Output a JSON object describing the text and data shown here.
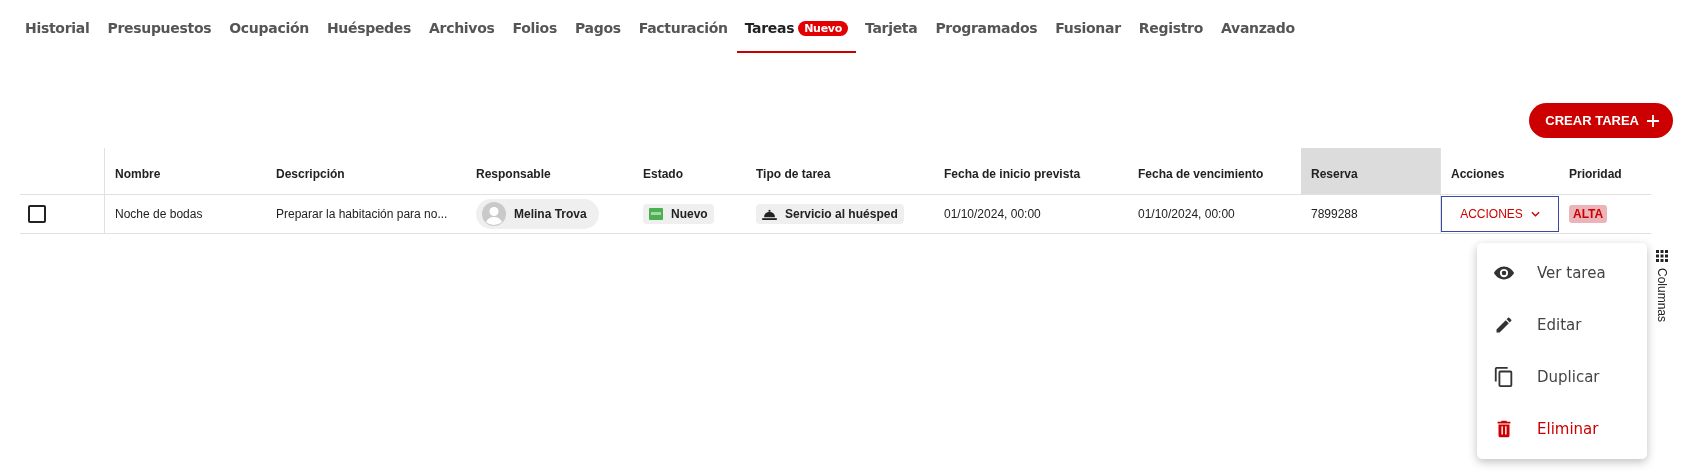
{
  "tabs": [
    {
      "label": "Historial",
      "selected": false
    },
    {
      "label": "Presupuestos",
      "selected": false
    },
    {
      "label": "Ocupación",
      "selected": false
    },
    {
      "label": "Huéspedes",
      "selected": false
    },
    {
      "label": "Archivos",
      "selected": false
    },
    {
      "label": "Folios",
      "selected": false
    },
    {
      "label": "Pagos",
      "selected": false
    },
    {
      "label": "Facturación",
      "selected": false
    },
    {
      "label": "Tareas",
      "selected": true,
      "badge": "Nuevo"
    },
    {
      "label": "Tarjeta",
      "selected": false
    },
    {
      "label": "Programados",
      "selected": false
    },
    {
      "label": "Fusionar",
      "selected": false
    },
    {
      "label": "Registro",
      "selected": false
    },
    {
      "label": "Avanzado",
      "selected": false
    }
  ],
  "create_button": "CREAR TAREA",
  "table": {
    "columns": [
      {
        "label": "Nombre",
        "highlighted": false
      },
      {
        "label": "Descripción",
        "highlighted": false
      },
      {
        "label": "Responsable",
        "highlighted": false
      },
      {
        "label": "Estado",
        "highlighted": false
      },
      {
        "label": "Tipo de tarea",
        "highlighted": false
      },
      {
        "label": "Fecha de inicio prevista",
        "highlighted": false
      },
      {
        "label": "Fecha de vencimiento",
        "highlighted": false
      },
      {
        "label": "Reserva",
        "highlighted": true
      },
      {
        "label": "Acciones",
        "highlighted": false
      },
      {
        "label": "Prioridad",
        "highlighted": false
      }
    ],
    "rows": [
      {
        "checked": false,
        "nombre": "Noche de bodas",
        "descripcion": "Preparar la habitación para no...",
        "responsable": "Melina Trova",
        "estado": "Nuevo",
        "tipo_de_tarea": "Servicio al huésped",
        "fecha_inicio": "01/10/2024, 00:00",
        "fecha_vencimiento": "01/10/2024, 00:00",
        "reserva": "7899288",
        "acciones": "ACCIONES",
        "prioridad": "ALTA"
      }
    ]
  },
  "column_tool": "Columnas",
  "menu": {
    "items": [
      {
        "label": "Ver tarea",
        "kind": "view"
      },
      {
        "label": "Editar",
        "kind": "edit"
      },
      {
        "label": "Duplicar",
        "kind": "duplicate"
      },
      {
        "label": "Eliminar",
        "kind": "delete"
      }
    ]
  }
}
